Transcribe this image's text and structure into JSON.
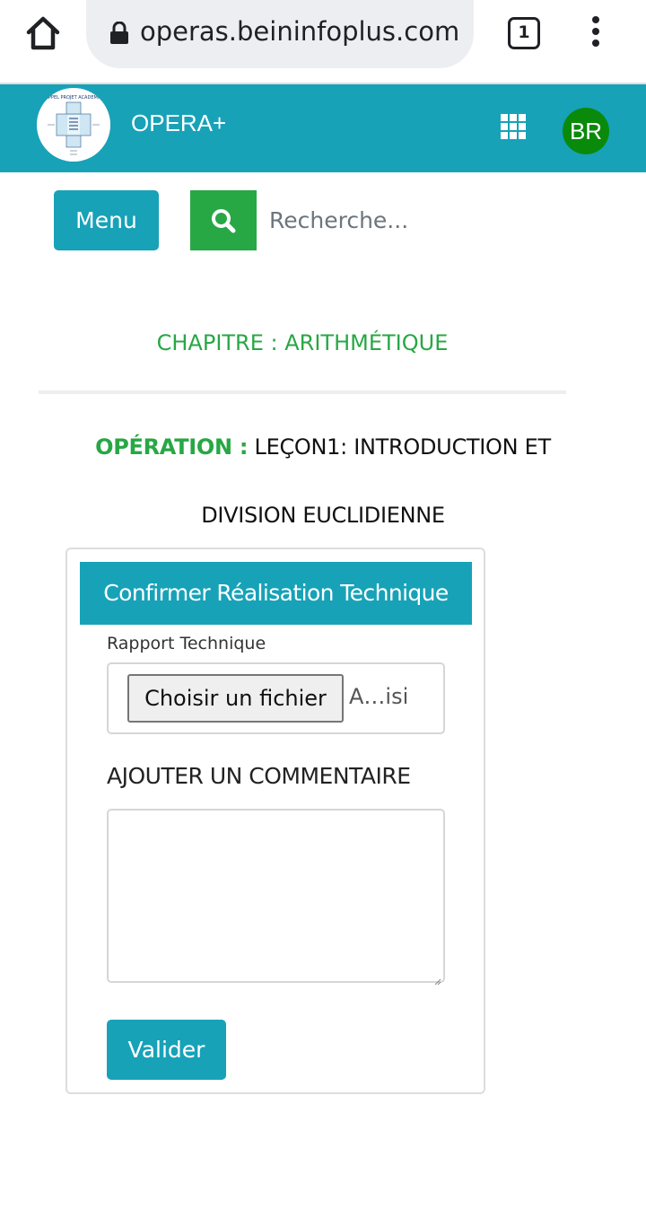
{
  "browser": {
    "url": "operas.beininfoplus.com",
    "tab_count": "1",
    "icons": {
      "home": "home-icon",
      "lock": "lock-icon",
      "more": "more-vert-icon"
    }
  },
  "header": {
    "brand": "OPERA+",
    "logo_alt": "APPEL PROJET ACADEMIE",
    "apps_icon": "apps-grid-icon",
    "avatar_initials": "BR",
    "colors": {
      "bar": "#17a2b8",
      "avatar": "#0a8a0a"
    }
  },
  "toolbar": {
    "menu_label": "Menu",
    "search_icon": "search-icon",
    "search_placeholder": "Recherche..."
  },
  "chapter": {
    "title": "CHAPITRE : ARITHMÉTIQUE"
  },
  "operation": {
    "label": "OPÉRATION :",
    "title_line1": "LEÇON1: INTRODUCTION ET",
    "title_line2": "DIVISION EUCLIDIENNE"
  },
  "form": {
    "header": "Confirmer Réalisation Technique",
    "file_label": "Rapport Technique",
    "file_button": "Choisir un fichier",
    "file_name": "A…isi",
    "comment_heading": "AJOUTER UN COMMENTAIRE",
    "comment_value": "",
    "submit_label": "Valider"
  },
  "colors": {
    "primary": "#17a2b8",
    "success": "#28a745"
  }
}
